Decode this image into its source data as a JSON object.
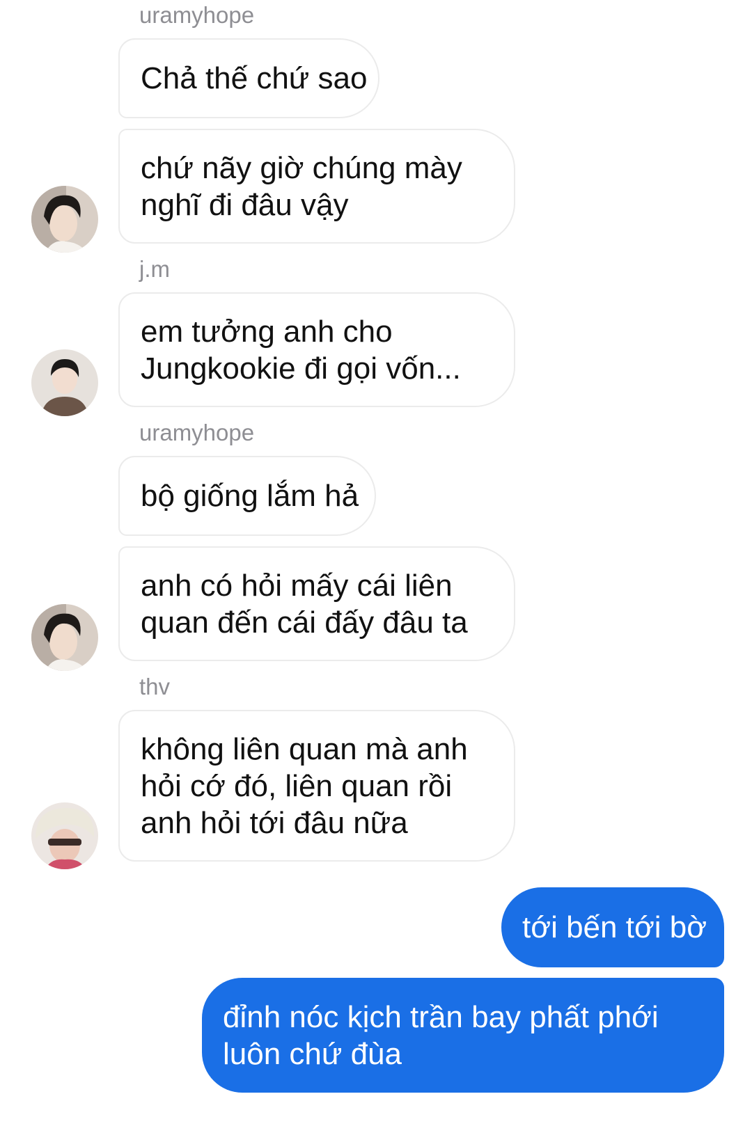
{
  "chat": {
    "sender_1": "uramyhope",
    "msg_1": "Chả thế chứ sao",
    "msg_2": [
      "chứ nãy giờ chúng mày",
      "nghĩ đi đâu vậy"
    ],
    "sender_2": "j.m",
    "msg_3": [
      "em tưởng anh cho",
      "Jungkookie đi gọi vốn..."
    ],
    "sender_3": "uramyhope",
    "msg_4": "bộ giống lắm hả",
    "msg_5": [
      "anh có hỏi mấy cái liên",
      "quan đến cái đấy đâu ta"
    ],
    "sender_4": "thv",
    "msg_6": [
      "không liên quan mà anh",
      "hỏi cớ đó, liên quan rồi",
      "anh hỏi tới đâu nữa"
    ],
    "out_1": "tới bến tới bờ",
    "out_2": [
      "đỉnh nóc kịch trần bay phất phới",
      "luôn chứ đùa"
    ]
  },
  "avatars": {
    "uramyhope": "avatar-photo",
    "jm": "avatar-photo",
    "thv": "avatar-photo"
  },
  "colors": {
    "outgoing_bubble": "#1a6fe6",
    "incoming_border": "#ebebeb",
    "sender_name": "#8e8e93"
  }
}
